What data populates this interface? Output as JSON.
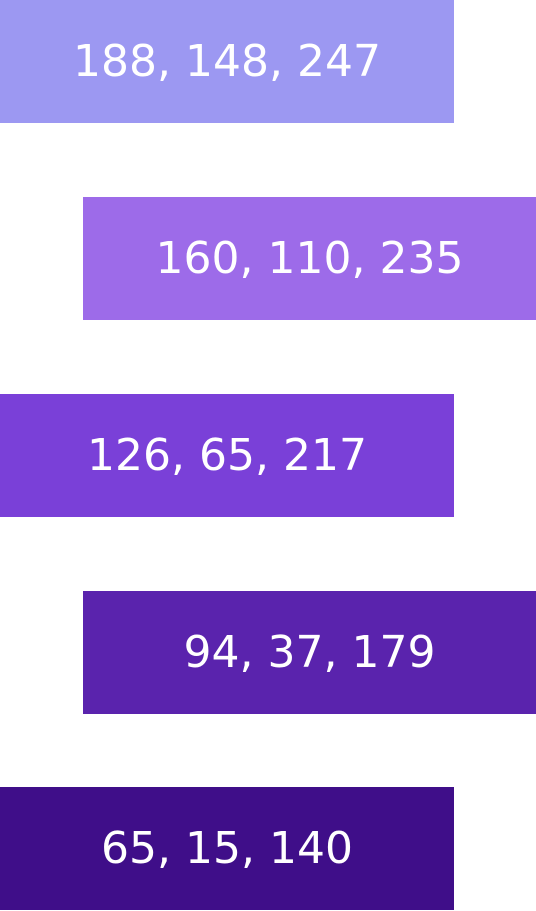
{
  "swatches": [
    {
      "label": "188, 148, 247",
      "color": "#9c98f2"
    },
    {
      "label": "160, 110, 235",
      "color": "#9d6be9"
    },
    {
      "label": "126, 65, 217",
      "color": "#7a40d8"
    },
    {
      "label": "94, 37, 179",
      "color": "#5a23ad"
    },
    {
      "label": "65, 15, 140",
      "color": "#3f0e89"
    }
  ]
}
